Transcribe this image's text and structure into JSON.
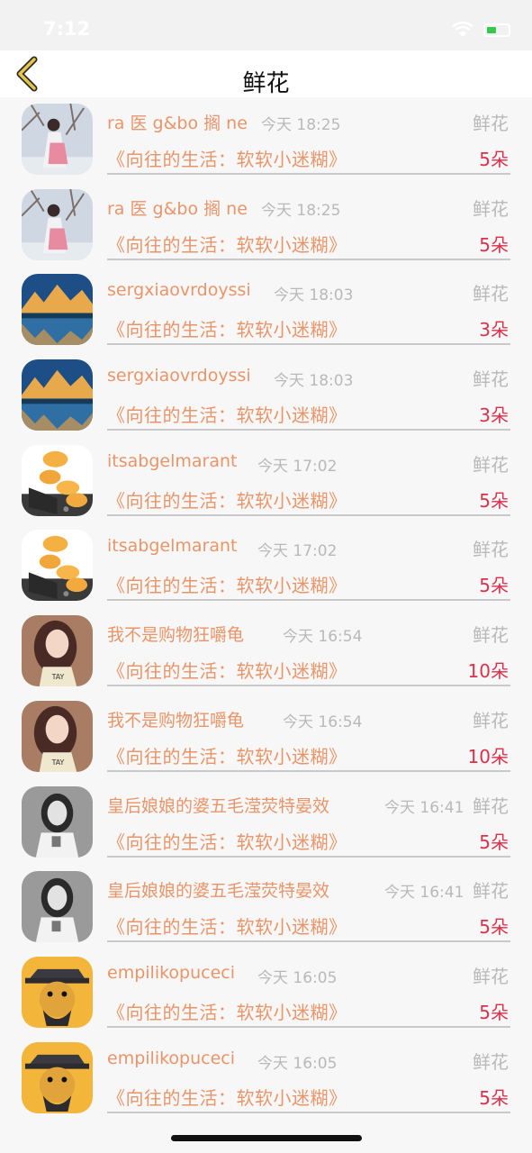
{
  "status_bar": {
    "time": "7:12"
  },
  "nav": {
    "title": "鲜花"
  },
  "rows": [
    {
      "name": "ra 医 g&bo 搁 ne",
      "time": "今天 18:25",
      "type": "鲜花",
      "gift": "《向往的生活：软软小迷糊》",
      "count": "5朵",
      "avatar": "avatar-winter-girl"
    },
    {
      "name": "ra 医 g&bo 搁 ne",
      "time": "今天 18:25",
      "type": "鲜花",
      "gift": "《向往的生活：软软小迷糊》",
      "count": "5朵",
      "avatar": "avatar-winter-girl"
    },
    {
      "name": "sergxiaovrdoyssi",
      "time": "今天 18:03",
      "type": "鲜花",
      "gift": "《向往的生活：软软小迷糊》",
      "count": "3朵",
      "avatar": "avatar-mountain-lake"
    },
    {
      "name": "sergxiaovrdoyssi",
      "time": "今天 18:03",
      "type": "鲜花",
      "gift": "《向往的生活：软软小迷糊》",
      "count": "3朵",
      "avatar": "avatar-mountain-lake"
    },
    {
      "name": "itsabgelmarant",
      "time": "今天 17:02",
      "type": "鲜花",
      "gift": "《向往的生活：软软小迷糊》",
      "count": "5朵",
      "avatar": "avatar-orange-shapes"
    },
    {
      "name": "itsabgelmarant",
      "time": "今天 17:02",
      "type": "鲜花",
      "gift": "《向往的生活：软软小迷糊》",
      "count": "5朵",
      "avatar": "avatar-orange-shapes"
    },
    {
      "name": "我不是购物狂嚼龟",
      "time": "今天 16:54",
      "type": "鲜花",
      "gift": "《向往的生活：软软小迷糊》",
      "count": "10朵",
      "avatar": "avatar-girl-portrait"
    },
    {
      "name": "我不是购物狂嚼龟",
      "time": "今天 16:54",
      "type": "鲜花",
      "gift": "《向往的生活：软软小迷糊》",
      "count": "10朵",
      "avatar": "avatar-girl-portrait"
    },
    {
      "name": "皇后娘娘的婆五毛滢荧特晏效",
      "time": "今天 16:41",
      "type": "鲜花",
      "gift": "《向往的生活：软软小迷糊》",
      "count": "5朵",
      "avatar": "avatar-bw-girl"
    },
    {
      "name": "皇后娘娘的婆五毛滢荧特晏效",
      "time": "今天 16:41",
      "type": "鲜花",
      "gift": "《向往的生活：软软小迷糊》",
      "count": "5朵",
      "avatar": "avatar-bw-girl"
    },
    {
      "name": "empilikopuceci",
      "time": "今天 16:05",
      "type": "鲜花",
      "gift": "《向往的生活：软软小迷糊》",
      "count": "5朵",
      "avatar": "avatar-cartoon-man"
    },
    {
      "name": "empilikopuceci",
      "time": "今天 16:05",
      "type": "鲜花",
      "gift": "《向往的生活：软软小迷糊》",
      "count": "5朵",
      "avatar": "avatar-cartoon-man"
    }
  ],
  "colors": {
    "accent": "#e8956a",
    "count": "#d9314b",
    "muted": "#b9b9b9",
    "back_arrow": "#e6c64a"
  }
}
